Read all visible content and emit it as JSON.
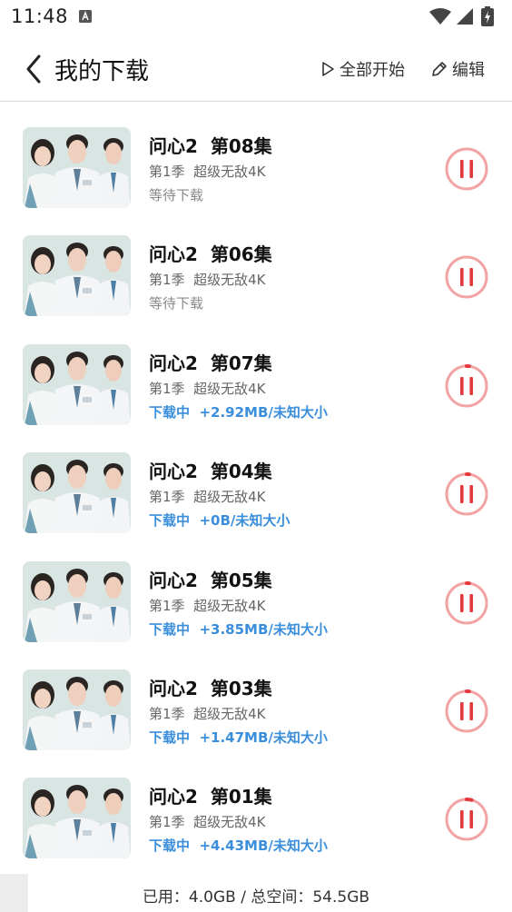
{
  "status_bar": {
    "time": "11:48"
  },
  "header": {
    "title": "我的下载",
    "start_all_label": "全部开始",
    "edit_label": "编辑"
  },
  "downloads": [
    {
      "title": "问心2  第08集",
      "subtitle": "第1季  超级无敌4K",
      "status": "等待下载",
      "progress": 0.0
    },
    {
      "title": "问心2  第06集",
      "subtitle": "第1季  超级无敌4K",
      "status": "等待下载",
      "progress": 0.0
    },
    {
      "title": "问心2  第07集",
      "subtitle": "第1季  超级无敌4K",
      "status": "下载中  +2.92MB/未知大小",
      "progress": 0.02
    },
    {
      "title": "问心2  第04集",
      "subtitle": "第1季  超级无敌4K",
      "status": "下载中  +0B/未知大小",
      "progress": 0.02
    },
    {
      "title": "问心2  第05集",
      "subtitle": "第1季  超级无敌4K",
      "status": "下载中  +3.85MB/未知大小",
      "progress": 0.02
    },
    {
      "title": "问心2  第03集",
      "subtitle": "第1季  超级无敌4K",
      "status": "下载中  +1.47MB/未知大小",
      "progress": 0.02
    },
    {
      "title": "问心2  第01集",
      "subtitle": "第1季  超级无敌4K",
      "status": "下载中  +4.43MB/未知大小",
      "progress": 0.04
    }
  ],
  "footer": {
    "storage_text": "已用：4.0GB / 总空间：54.5GB"
  },
  "colors": {
    "accent_blue": "#3a8edb",
    "pause_red": "#e3393c",
    "pause_ring": "#f2a3a4"
  }
}
